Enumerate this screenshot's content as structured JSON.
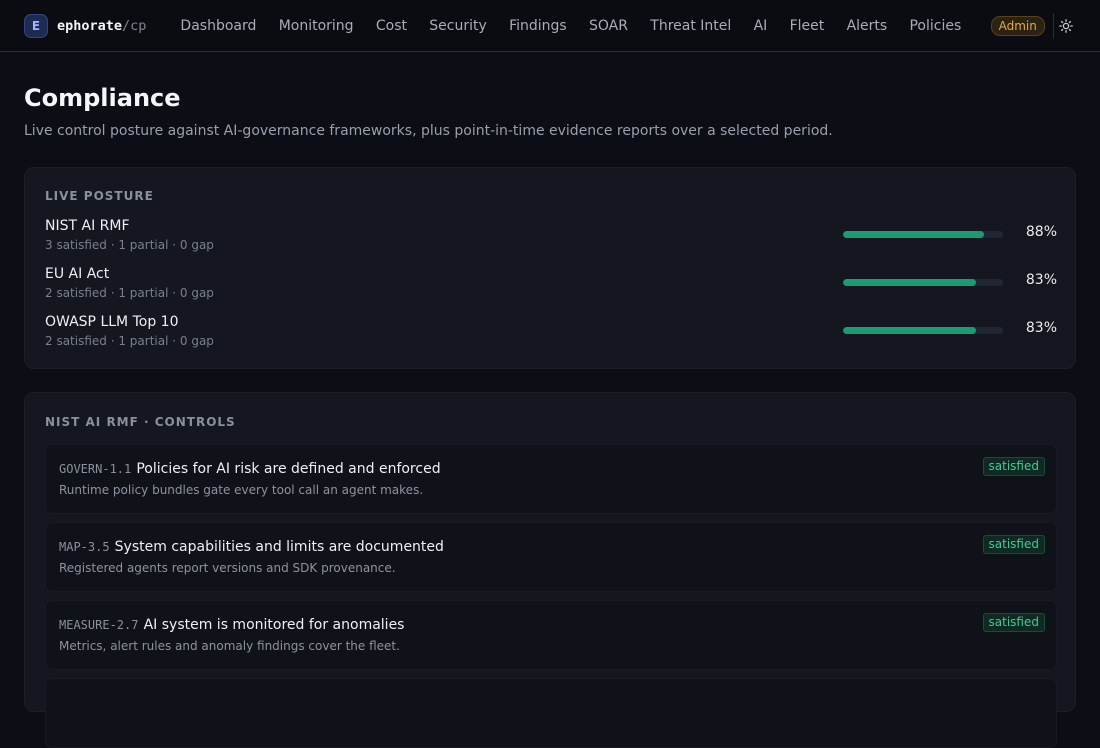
{
  "brand": {
    "badge": "E",
    "name": "ephorate",
    "suffix": "/cp"
  },
  "nav": {
    "items": [
      {
        "label": "Dashboard"
      },
      {
        "label": "Monitoring"
      },
      {
        "label": "Cost"
      },
      {
        "label": "Security"
      },
      {
        "label": "Findings"
      },
      {
        "label": "SOAR"
      },
      {
        "label": "Threat Intel"
      },
      {
        "label": "AI"
      },
      {
        "label": "Fleet"
      },
      {
        "label": "Alerts"
      },
      {
        "label": "Policies"
      }
    ],
    "role": "Admin",
    "theme_icon": "sun-icon"
  },
  "page": {
    "title": "Compliance",
    "subtitle": "Live control posture against AI-governance frameworks, plus point-in-time evidence reports over a selected period."
  },
  "posture": {
    "label": "LIVE POSTURE",
    "frameworks": [
      {
        "name": "NIST AI RMF",
        "meta": "3 satisfied · 1 partial · 0 gap",
        "score": 88,
        "score_label": "88%"
      },
      {
        "name": "EU AI Act",
        "meta": "2 satisfied · 1 partial · 0 gap",
        "score": 83,
        "score_label": "83%"
      },
      {
        "name": "OWASP LLM Top 10",
        "meta": "2 satisfied · 1 partial · 0 gap",
        "score": 83,
        "score_label": "83%"
      }
    ]
  },
  "controls": {
    "label": "NIST AI RMF · CONTROLS",
    "items": [
      {
        "id": "GOVERN-1.1",
        "title": "Policies for AI risk are defined and enforced",
        "description": "Runtime policy bundles gate every tool call an agent makes.",
        "status": "satisfied"
      },
      {
        "id": "MAP-3.5",
        "title": "System capabilities and limits are documented",
        "description": "Registered agents report versions and SDK provenance.",
        "status": "satisfied"
      },
      {
        "id": "MEASURE-2.7",
        "title": "AI system is monitored for anomalies",
        "description": "Metrics, alert rules and anomaly findings cover the fleet.",
        "status": "satisfied"
      }
    ]
  },
  "colors": {
    "background": "#0c0e15",
    "card": "#141720",
    "accent_green": "#1d9a72",
    "status_satisfied": "#49c796",
    "admin_badge": "#e0a94a"
  }
}
